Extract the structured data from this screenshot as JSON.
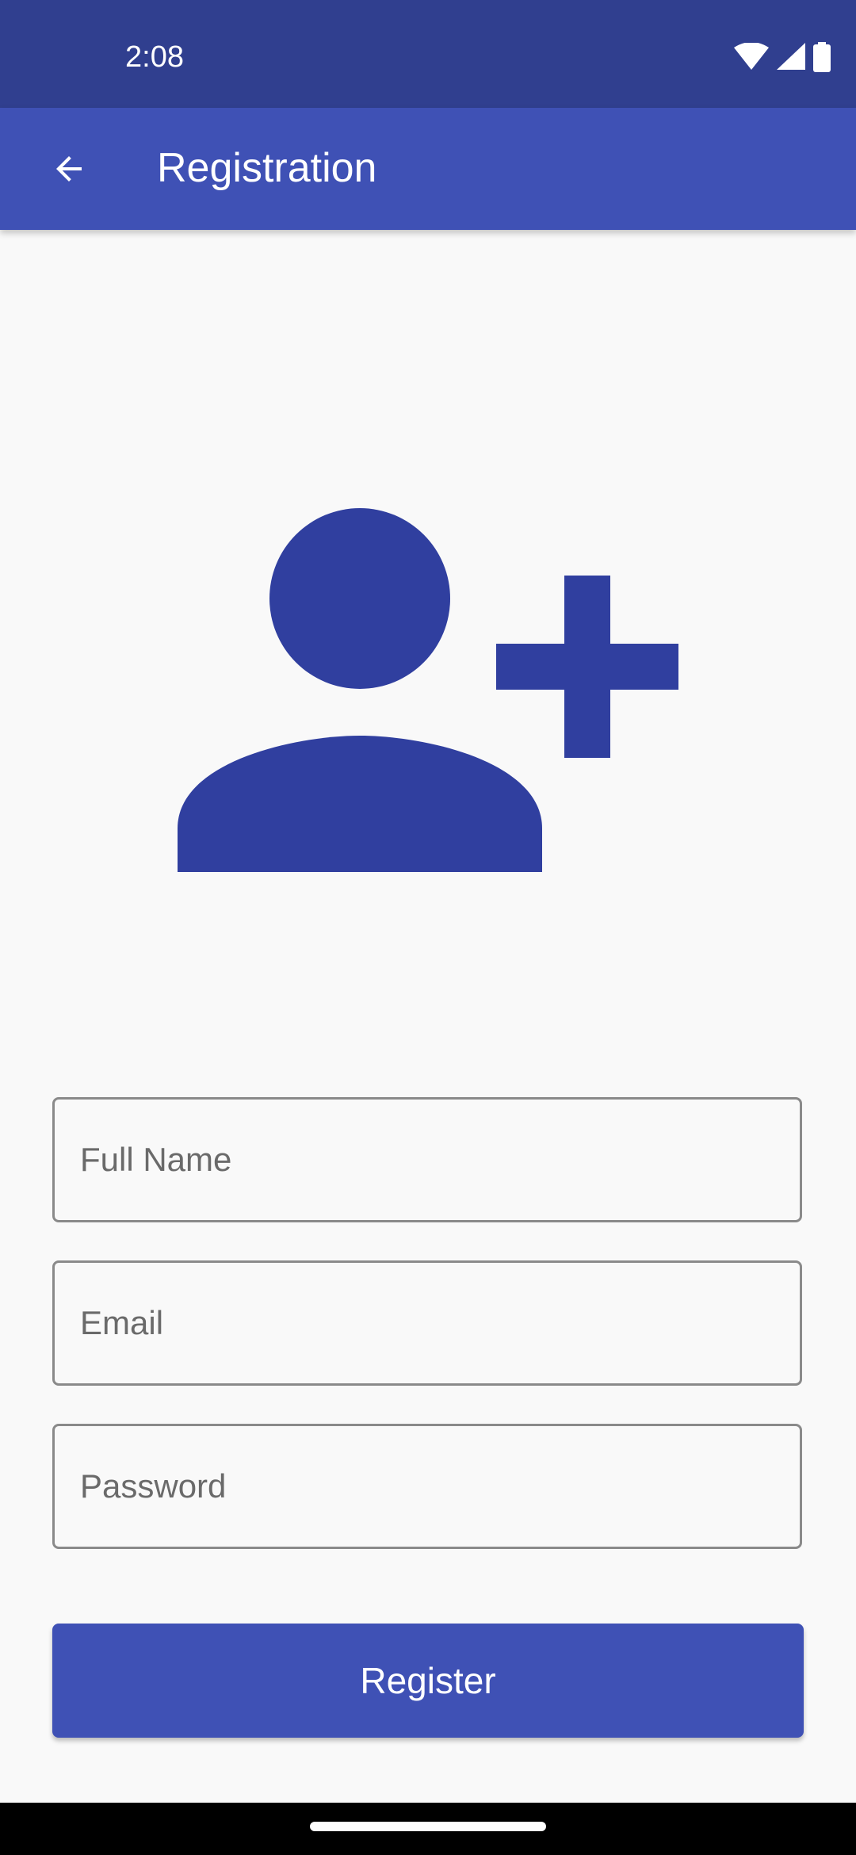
{
  "status_bar": {
    "time": "2:08",
    "icons": [
      "wifi-icon",
      "cellular-signal-icon",
      "battery-icon"
    ]
  },
  "app_bar": {
    "back_icon": "arrow-left-icon",
    "title": "Registration"
  },
  "hero": {
    "icon": "person-add-icon"
  },
  "form": {
    "full_name_placeholder": "Full Name",
    "email_placeholder": "Email",
    "password_placeholder": "Password",
    "register_label": "Register"
  },
  "colors": {
    "status_bar": "#303f8f",
    "primary": "#3f51b5",
    "hero_icon": "#303f9f",
    "background": "#f9f9f9",
    "field_border": "#8a8a8a"
  }
}
